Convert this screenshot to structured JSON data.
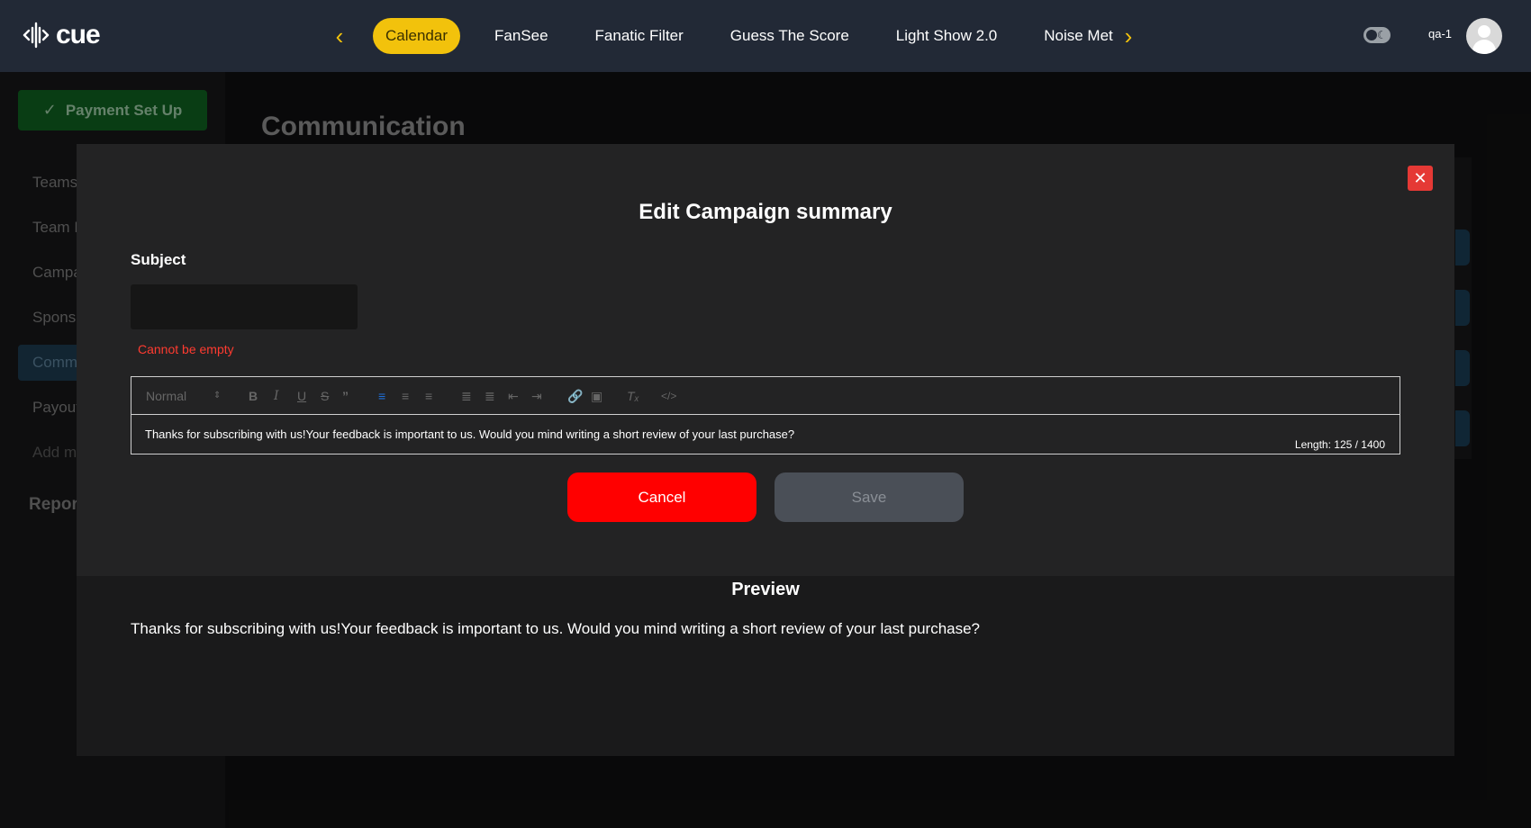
{
  "header": {
    "logo_text": "cue",
    "tabs": [
      {
        "label": "Calendar",
        "active": true
      },
      {
        "label": "FanSee",
        "active": false
      },
      {
        "label": "Fanatic Filter",
        "active": false
      },
      {
        "label": "Guess The Score",
        "active": false
      },
      {
        "label": "Light Show 2.0",
        "active": false
      },
      {
        "label": "Noise Met",
        "active": false
      }
    ],
    "username": "qa-1",
    "accent_color": "#f2c20c"
  },
  "sidebar": {
    "payment_button": "Payment Set Up",
    "items": [
      "Teams",
      "Team I",
      "Campa",
      "Sponsi",
      "Comm",
      "Payout",
      "Add m"
    ],
    "active_index": 4,
    "report_label": "Report"
  },
  "page": {
    "title": "Communication"
  },
  "modal": {
    "title": "Edit Campaign summary",
    "subject_label": "Subject",
    "subject_value": "",
    "error_text": "Cannot be empty",
    "editor": {
      "format_select": "Normal",
      "content": "Thanks for subscribing with us!Your feedback is important to us. Would you mind writing a short review of your last purchase?",
      "length_label": "Length: 125 / 1400"
    },
    "cancel_label": "Cancel",
    "save_label": "Save",
    "preview_title": "Preview",
    "preview_text": "Thanks for subscribing with us!Your feedback is important to us. Would you mind writing a short review of your last purchase?"
  }
}
